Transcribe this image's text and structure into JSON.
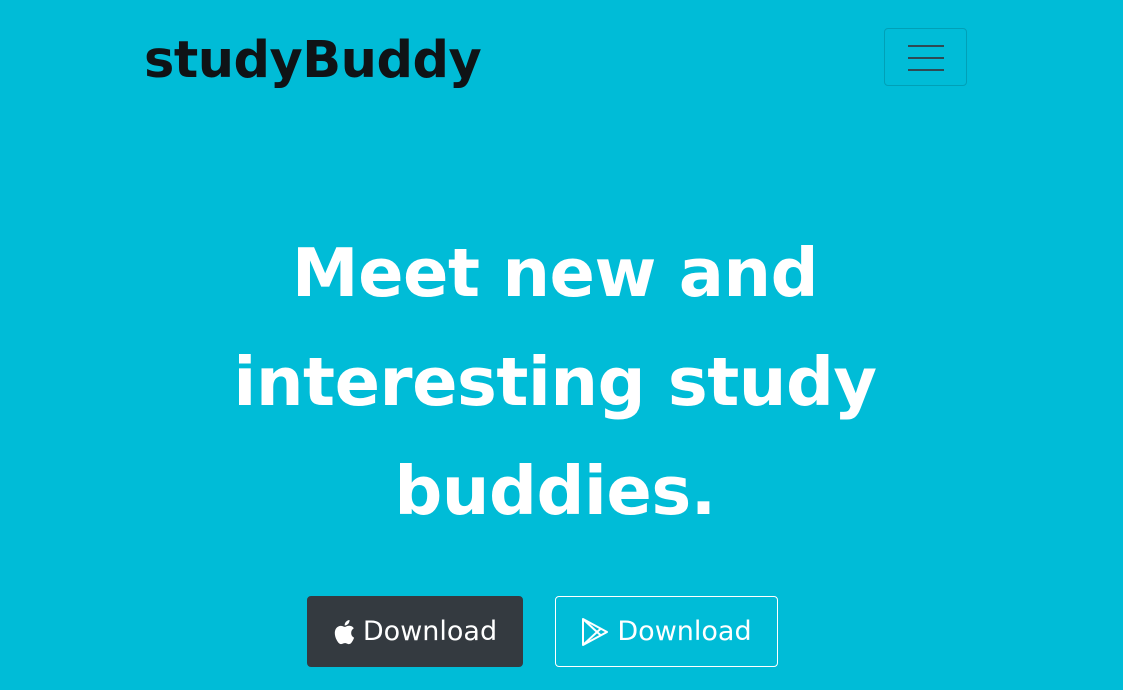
{
  "navbar": {
    "brand": "studyBuddy",
    "toggler_icon": "hamburger-menu-icon"
  },
  "hero": {
    "headline": "Meet new and interesting study buddies.",
    "buttons": [
      {
        "label": "Download",
        "icon": "apple-icon",
        "style": "dark"
      },
      {
        "label": "Download",
        "icon": "google-play-icon",
        "style": "outline-light"
      }
    ]
  },
  "colors": {
    "background": "#00bcd7",
    "brand_text": "#0f1316",
    "headline_text": "#ffffff",
    "dark_button": "#343a40"
  }
}
